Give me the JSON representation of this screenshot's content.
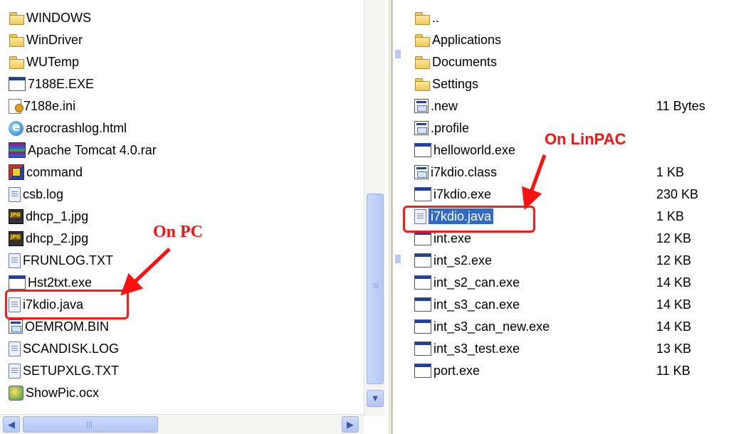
{
  "left_pane": {
    "files": [
      {
        "name": "WINDOWS",
        "icon": "folder-icon",
        "kind": "folder"
      },
      {
        "name": "WinDriver",
        "icon": "folder-icon",
        "kind": "folder"
      },
      {
        "name": "WUTemp",
        "icon": "folder-icon",
        "kind": "folder"
      },
      {
        "name": "7188E.EXE",
        "icon": "exe-icon",
        "kind": "exe"
      },
      {
        "name": "7188e.ini",
        "icon": "ini-file-icon",
        "kind": "ini"
      },
      {
        "name": "acrocrashlog.html",
        "icon": "html-file-icon",
        "kind": "html"
      },
      {
        "name": "Apache Tomcat 4.0.rar",
        "icon": "rar-archive-icon",
        "kind": "rar"
      },
      {
        "name": "command",
        "icon": "command-icon",
        "kind": "cmd"
      },
      {
        "name": "csb.log",
        "icon": "text-file-icon",
        "kind": "doc"
      },
      {
        "name": "dhcp_1.jpg",
        "icon": "jpg-file-icon",
        "kind": "jpg"
      },
      {
        "name": "dhcp_2.jpg",
        "icon": "jpg-file-icon",
        "kind": "jpg"
      },
      {
        "name": "FRUNLOG.TXT",
        "icon": "text-file-icon",
        "kind": "doc"
      },
      {
        "name": "Hst2txt.exe",
        "icon": "exe-icon",
        "kind": "exe"
      },
      {
        "name": "i7kdio.java",
        "icon": "text-file-icon",
        "kind": "doc"
      },
      {
        "name": "OEMROM.BIN",
        "icon": "bin-file-icon",
        "kind": "bin"
      },
      {
        "name": "SCANDISK.LOG",
        "icon": "text-file-icon",
        "kind": "doc"
      },
      {
        "name": "SETUPXLG.TXT",
        "icon": "text-file-icon",
        "kind": "doc"
      },
      {
        "name": "ShowPic.ocx",
        "icon": "ocx-file-icon",
        "kind": "ocx"
      }
    ]
  },
  "right_pane": {
    "files": [
      {
        "name": "..",
        "size": "",
        "icon": "folder-icon",
        "kind": "folder"
      },
      {
        "name": "Applications",
        "size": "",
        "icon": "folder-icon",
        "kind": "folder"
      },
      {
        "name": "Documents",
        "size": "",
        "icon": "folder-icon",
        "kind": "folder"
      },
      {
        "name": "Settings",
        "size": "",
        "icon": "folder-icon",
        "kind": "folder"
      },
      {
        "name": ".new",
        "size": "11 Bytes",
        "icon": "bin-file-icon",
        "kind": "bin"
      },
      {
        "name": ".profile",
        "size": "",
        "icon": "bin-file-icon",
        "kind": "bin"
      },
      {
        "name": "helloworld.exe",
        "size": "",
        "icon": "exe-icon",
        "kind": "exe"
      },
      {
        "name": "i7kdio.class",
        "size": "1 KB",
        "icon": "bin-file-icon",
        "kind": "bin"
      },
      {
        "name": "i7kdio.exe",
        "size": "230 KB",
        "icon": "exe-icon",
        "kind": "exe"
      },
      {
        "name": "i7kdio.java",
        "size": "1 KB",
        "icon": "text-file-icon",
        "kind": "doc",
        "selected": true
      },
      {
        "name": "int.exe",
        "size": "12 KB",
        "icon": "exe-icon",
        "kind": "exe"
      },
      {
        "name": "int_s2.exe",
        "size": "12 KB",
        "icon": "exe-icon",
        "kind": "exe"
      },
      {
        "name": "int_s2_can.exe",
        "size": "14 KB",
        "icon": "exe-icon",
        "kind": "exe"
      },
      {
        "name": "int_s3_can.exe",
        "size": "14 KB",
        "icon": "exe-icon",
        "kind": "exe"
      },
      {
        "name": "int_s3_can_new.exe",
        "size": "14 KB",
        "icon": "exe-icon",
        "kind": "exe"
      },
      {
        "name": "int_s3_test.exe",
        "size": "13 KB",
        "icon": "exe-icon",
        "kind": "exe"
      },
      {
        "name": "port.exe",
        "size": "11 KB",
        "icon": "exe-icon",
        "kind": "exe"
      }
    ]
  },
  "annotations": {
    "pc_label": "On PC",
    "linpac_label": "On LinPAC",
    "color": "#ff1010"
  },
  "colors": {
    "selection": "#316ac5",
    "scrollbar_thumb": "#b5c9f6"
  }
}
